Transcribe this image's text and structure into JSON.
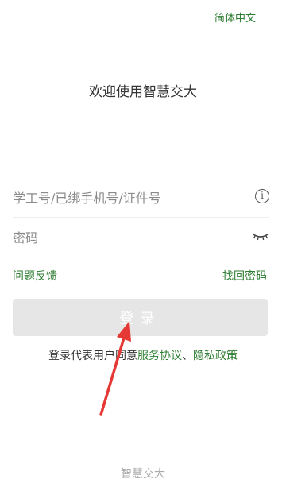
{
  "header": {
    "language_switch": "简体中文"
  },
  "welcome_title": "欢迎使用智慧交大",
  "account_field": {
    "placeholder": "学工号/已绑手机号/证件号",
    "info_icon": "info-icon"
  },
  "password_field": {
    "placeholder": "密码",
    "visibility_icon": "eye-closed-icon"
  },
  "links": {
    "feedback": "问题反馈",
    "forgot_password": "找回密码"
  },
  "login_button": {
    "label": "登录"
  },
  "agreement": {
    "prefix": "登录代表用户同意",
    "service_agreement": "服务协议",
    "separator": "、",
    "privacy_policy": "隐私政策"
  },
  "footer": {
    "brand": "智慧交大"
  },
  "colors": {
    "accent_green": "#2e7d32",
    "button_disabled_bg": "#e6e6e6",
    "annotation_arrow": "#e53935"
  }
}
